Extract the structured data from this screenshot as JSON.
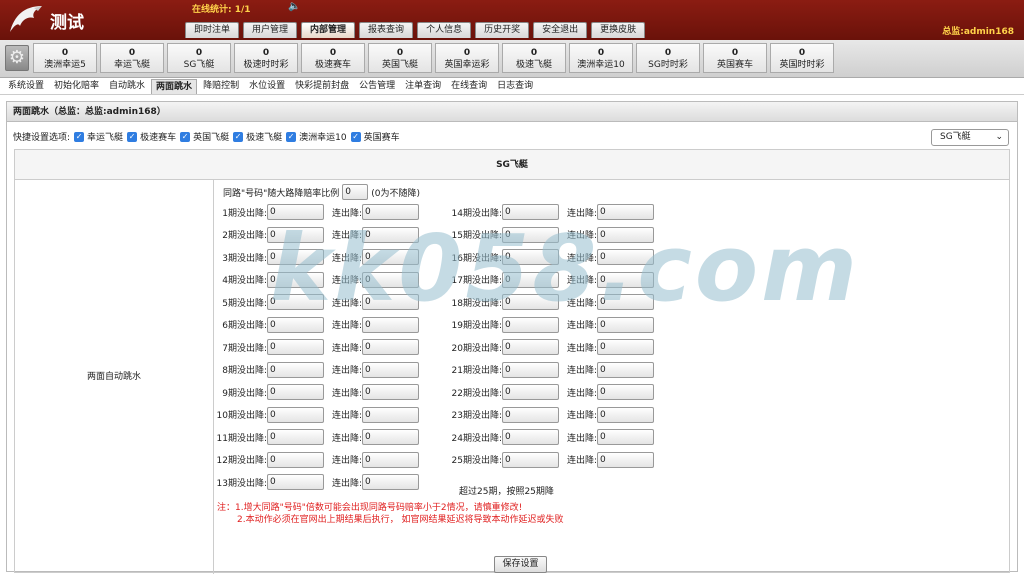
{
  "header": {
    "app_title": "测试",
    "online_label": "在线统计: 1/1",
    "user_label": "总监:admin168",
    "nav": [
      "即时注单",
      "用户管理",
      "内部管理",
      "报表查询",
      "个人信息",
      "历史开奖",
      "安全退出",
      "更换皮肤"
    ],
    "active_nav": "内部管理"
  },
  "games": [
    {
      "count": "0",
      "name": "澳洲幸运5"
    },
    {
      "count": "0",
      "name": "幸运飞艇"
    },
    {
      "count": "0",
      "name": "SG飞艇"
    },
    {
      "count": "0",
      "name": "极速时时彩"
    },
    {
      "count": "0",
      "name": "极速赛车"
    },
    {
      "count": "0",
      "name": "英国飞艇"
    },
    {
      "count": "0",
      "name": "英国幸运彩"
    },
    {
      "count": "0",
      "name": "极速飞艇"
    },
    {
      "count": "0",
      "name": "澳洲幸运10"
    },
    {
      "count": "0",
      "name": "SG时时彩"
    },
    {
      "count": "0",
      "name": "英国赛车"
    },
    {
      "count": "0",
      "name": "英国时时彩"
    }
  ],
  "subnav": [
    "系统设置",
    "初始化赔率",
    "自动跳水",
    "两面跳水",
    "降赔控制",
    "水位设置",
    "快彩提前封盘",
    "公告管理",
    "注单查询",
    "在线查询",
    "日志查询"
  ],
  "active_subnav": "两面跳水",
  "panel": {
    "title": "两面跳水（总监：总监:admin168）",
    "quick_label": "快捷设置选项:",
    "quick_options": [
      "幸运飞艇",
      "极速赛车",
      "英国飞艇",
      "极速飞艇",
      "澳洲幸运10",
      "英国赛车"
    ],
    "select_value": "SG飞艇",
    "table_title": "SG飞艇",
    "left_label": "两面自动跳水",
    "ratio_prefix": "同路\"号码\"随大路降赔率比例",
    "ratio_value": "0",
    "ratio_suffix": "(0为不随降)",
    "left_rows": [
      {
        "label": "1期没出降:",
        "v1": "0",
        "label2": "连出降:",
        "v2": "0"
      },
      {
        "label": "2期没出降:",
        "v1": "0",
        "label2": "连出降:",
        "v2": "0"
      },
      {
        "label": "3期没出降:",
        "v1": "0",
        "label2": "连出降:",
        "v2": "0"
      },
      {
        "label": "4期没出降:",
        "v1": "0",
        "label2": "连出降:",
        "v2": "0"
      },
      {
        "label": "5期没出降:",
        "v1": "0",
        "label2": "连出降:",
        "v2": "0"
      },
      {
        "label": "6期没出降:",
        "v1": "0",
        "label2": "连出降:",
        "v2": "0"
      },
      {
        "label": "7期没出降:",
        "v1": "0",
        "label2": "连出降:",
        "v2": "0"
      },
      {
        "label": "8期没出降:",
        "v1": "0",
        "label2": "连出降:",
        "v2": "0"
      },
      {
        "label": "9期没出降:",
        "v1": "0",
        "label2": "连出降:",
        "v2": "0"
      },
      {
        "label": "10期没出降:",
        "v1": "0",
        "label2": "连出降:",
        "v2": "0"
      },
      {
        "label": "11期没出降:",
        "v1": "0",
        "label2": "连出降:",
        "v2": "0"
      },
      {
        "label": "12期没出降:",
        "v1": "0",
        "label2": "连出降:",
        "v2": "0"
      },
      {
        "label": "13期没出降:",
        "v1": "0",
        "label2": "连出降:",
        "v2": "0"
      }
    ],
    "right_rows": [
      {
        "label": "14期没出降:",
        "v1": "0",
        "label2": "连出降:",
        "v2": "0"
      },
      {
        "label": "15期没出降:",
        "v1": "0",
        "label2": "连出降:",
        "v2": "0"
      },
      {
        "label": "16期没出降:",
        "v1": "0",
        "label2": "连出降:",
        "v2": "0"
      },
      {
        "label": "17期没出降:",
        "v1": "0",
        "label2": "连出降:",
        "v2": "0"
      },
      {
        "label": "18期没出降:",
        "v1": "0",
        "label2": "连出降:",
        "v2": "0"
      },
      {
        "label": "19期没出降:",
        "v1": "0",
        "label2": "连出降:",
        "v2": "0"
      },
      {
        "label": "20期没出降:",
        "v1": "0",
        "label2": "连出降:",
        "v2": "0"
      },
      {
        "label": "21期没出降:",
        "v1": "0",
        "label2": "连出降:",
        "v2": "0"
      },
      {
        "label": "22期没出降:",
        "v1": "0",
        "label2": "连出降:",
        "v2": "0"
      },
      {
        "label": "23期没出降:",
        "v1": "0",
        "label2": "连出降:",
        "v2": "0"
      },
      {
        "label": "24期没出降:",
        "v1": "0",
        "label2": "连出降:",
        "v2": "0"
      },
      {
        "label": "25期没出降:",
        "v1": "0",
        "label2": "连出降:",
        "v2": "0"
      }
    ],
    "over_text": "超过25期，按照25期降",
    "note1": "注：1.增大同路\"号码\"倍数可能会出现同路号码赔率小于2情况，请慎重修改!",
    "note2": "2.本动作必须在官网出上期结果后执行， 如官网结果延迟将导致本动作延迟或失败",
    "save_label": "保存设置"
  },
  "watermark": "kk058.com"
}
